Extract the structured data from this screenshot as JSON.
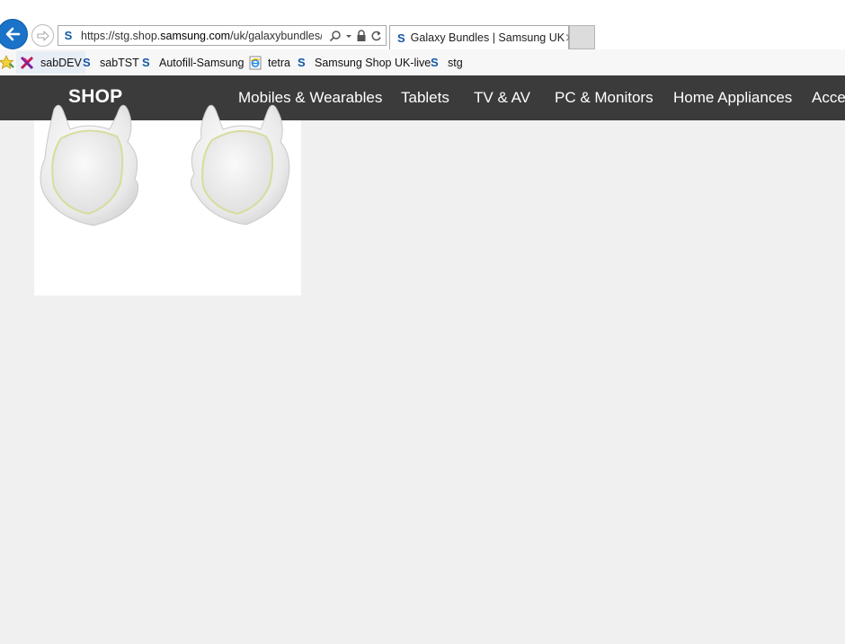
{
  "browser": {
    "url": {
      "prefix": "https://stg.shop.",
      "domain": "samsung.com",
      "path": "/uk/galaxybundles/"
    },
    "tab_title": "Galaxy Bundles | Samsung UK",
    "tab_close": "×"
  },
  "favorites": [
    {
      "label": "sabDEV",
      "icon": "tools-icon"
    },
    {
      "label": "sabTST",
      "icon": "samsung-s-icon"
    },
    {
      "label": "Autofill-Samsung",
      "icon": "samsung-s-icon"
    },
    {
      "label": "tetra",
      "icon": "ie-page-icon"
    },
    {
      "label": "Samsung Shop UK-live",
      "icon": "samsung-s-icon"
    },
    {
      "label": "stg",
      "icon": "samsung-s-icon"
    }
  ],
  "favicon_letter": "S",
  "nav": {
    "logo": "SHOP",
    "links": [
      "Mobiles & Wearables",
      "Tablets",
      "TV & AV",
      "PC & Monitors",
      "Home Appliances",
      "Acce"
    ]
  },
  "colors": {
    "nav_bg": "#3b3b3b",
    "back_button": "#1a73c8",
    "samsung_blue": "#1458a5",
    "page_bg": "#f0f0f0"
  }
}
